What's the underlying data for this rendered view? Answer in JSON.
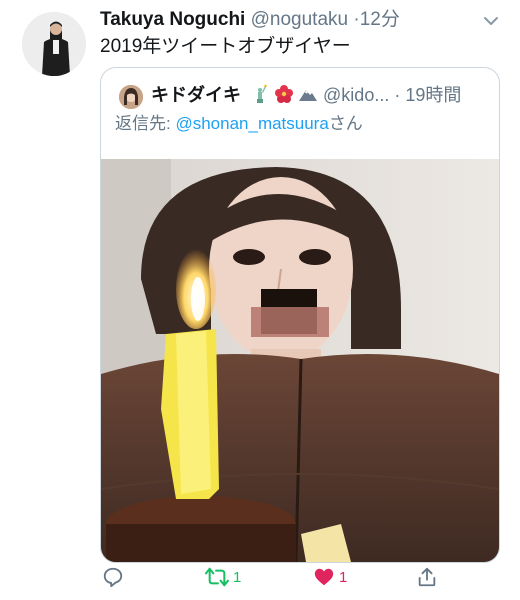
{
  "tweet": {
    "author_name": "Takuya Noguchi",
    "author_handle": "@nogutaku",
    "separator": "·",
    "time": "12分",
    "text": "2019年ツイートオブザイヤー"
  },
  "quoted": {
    "author_name": "キドダイキ",
    "author_emojis": [
      "statue-of-liberty-icon",
      "hibiscus-icon",
      "mountain-icon"
    ],
    "author_handle": "@kido...",
    "separator": "·",
    "time": "19時間",
    "reply_prefix": "返信先: ",
    "reply_mention": "@shonan_matsuura",
    "reply_suffix": "さん"
  },
  "actions": {
    "reply_count": "",
    "retweet_count": "1",
    "like_count": "1",
    "retweet_color": "#17bf63",
    "like_color": "#e0245e"
  },
  "icons": [
    "reply-icon",
    "retweet-icon",
    "like-icon",
    "share-icon",
    "chevron-down-icon"
  ]
}
